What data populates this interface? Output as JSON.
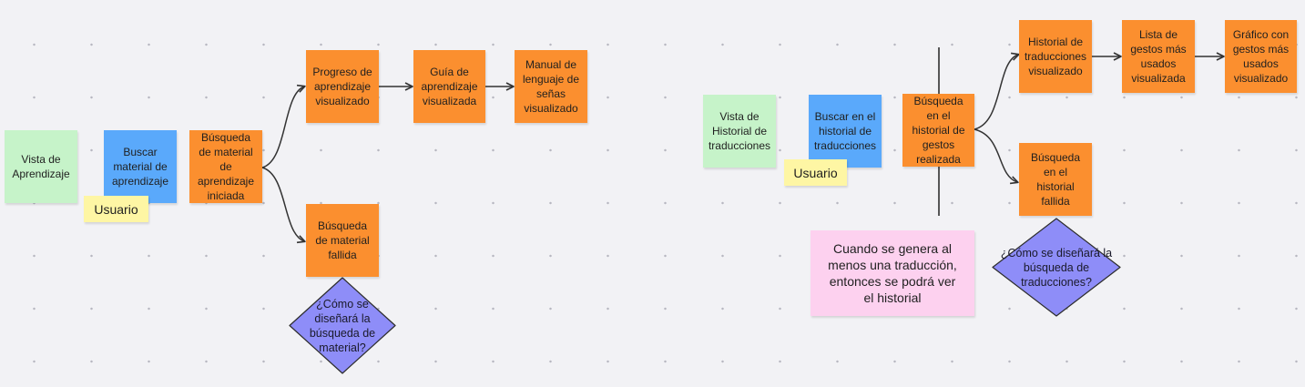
{
  "board": {
    "left_flow": {
      "vista": "Vista de Aprendizaje",
      "buscar": "Buscar material de aprendizaje",
      "usuario": "Usuario",
      "busqueda_iniciada": "Búsqueda de material de aprendizaje iniciada",
      "progreso": "Progreso de aprendizaje visualizado",
      "guia": "Guía de aprendizaje visualizada",
      "manual": "Manual de lenguaje de señas visualizado",
      "fallida": "Búsqueda de material fallida",
      "pregunta": "¿Cómo se diseñará la búsqueda de material?"
    },
    "right_flow": {
      "vista": "Vista de Historial de traducciones",
      "buscar": "Buscar en el historial de traducciones",
      "usuario": "Usuario",
      "busqueda_realizada": "Búsqueda en el historial de gestos realizada",
      "historial": "Historial de traducciones visualizado",
      "lista": "Lista de gestos más usados visualizada",
      "grafico": "Gráfico con gestos más usados visualizado",
      "fallida": "Búsqueda en el historial fallida",
      "pregunta": "¿Cómo se diseñará la búsqueda de traducciones?",
      "nota": "Cuando se genera al menos una traducción, entonces se podrá ver el historial"
    }
  },
  "colors": {
    "green_note": "#c6f3c9",
    "blue_note": "#5aa9fb",
    "orange_note": "#fb8f2f",
    "yellow_note": "#fef6a4",
    "pink_note": "#fdd1ef",
    "diamond_fill": "#8e8df8",
    "connector": "#333333"
  }
}
